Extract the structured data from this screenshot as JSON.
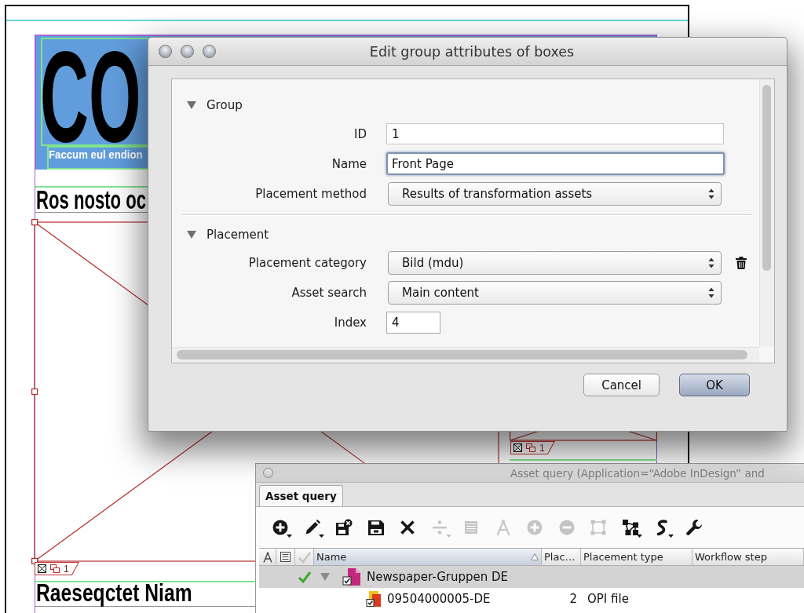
{
  "layout": {
    "masthead": {
      "title": "CO",
      "subtitle": "Faccum eul endion"
    },
    "headlines": [
      "Ros nosto oc",
      "Raeseqctet Niam"
    ],
    "frame_tags": [
      {
        "number": "1"
      },
      {
        "number": "1"
      }
    ]
  },
  "dialog": {
    "title": "Edit group attributes of boxes",
    "sections": [
      {
        "title": "Group",
        "expanded": true,
        "fields": [
          {
            "label": "ID",
            "kind": "text",
            "value": "1",
            "focused": false,
            "removable": false
          },
          {
            "label": "Name",
            "kind": "text",
            "value": "Front Page",
            "focused": true,
            "removable": false
          },
          {
            "label": "Placement method",
            "kind": "select",
            "value": "Results of transformation assets",
            "focused": false,
            "removable": false
          }
        ]
      },
      {
        "title": "Placement",
        "expanded": true,
        "fields": [
          {
            "label": "Placement category",
            "kind": "select",
            "value": "Bild (mdu)",
            "focused": false,
            "removable": true
          },
          {
            "label": "Asset search",
            "kind": "select",
            "value": "Main content",
            "focused": false,
            "removable": false
          },
          {
            "label": "Index",
            "kind": "number",
            "value": "4",
            "focused": false,
            "removable": false
          }
        ]
      }
    ],
    "buttons": [
      {
        "label": "Cancel",
        "default": false
      },
      {
        "label": "OK",
        "default": true
      }
    ]
  },
  "asset_panel": {
    "title": "Asset query (Application=“Adobe InDesign” and",
    "tabs": [
      {
        "label": "Asset query",
        "selected": true
      }
    ],
    "toolbar": [
      {
        "disabled": false,
        "menu": true
      },
      {
        "disabled": false,
        "menu": true
      },
      {
        "disabled": false,
        "menu": false
      },
      {
        "disabled": false,
        "menu": false
      },
      {
        "disabled": false,
        "menu": false
      },
      {
        "disabled": true,
        "menu": true
      },
      {
        "disabled": true,
        "menu": false
      },
      {
        "disabled": true,
        "menu": false
      },
      {
        "disabled": true,
        "menu": false
      },
      {
        "disabled": true,
        "menu": false
      },
      {
        "disabled": true,
        "menu": false
      },
      {
        "disabled": false,
        "menu": true
      },
      {
        "disabled": false,
        "menu": true
      },
      {
        "disabled": false,
        "menu": false
      }
    ],
    "columns": [
      {
        "label": "Name",
        "sorted": true
      },
      {
        "label": "Plac…",
        "sorted": false
      },
      {
        "label": "Placement type",
        "sorted": false
      },
      {
        "label": "Workflow step",
        "sorted": false
      }
    ],
    "rows": [
      {
        "name": "Newspaper-Gruppen DE",
        "kind": "document",
        "checked": true,
        "selected": true,
        "expanded": true,
        "children": [
          {
            "name": "09504000005-DE",
            "kind": "file",
            "checked": false,
            "selected": false,
            "placements": "2",
            "placement_type": "OPI file"
          }
        ]
      }
    ]
  }
}
